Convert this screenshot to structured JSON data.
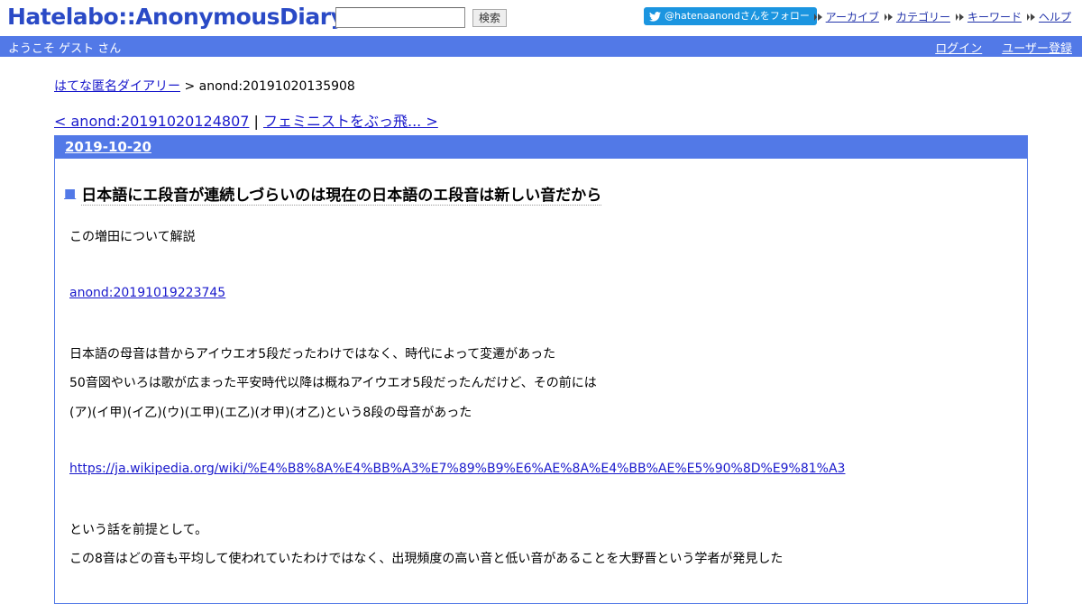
{
  "header": {
    "logo": "Hatelabo::AnonymousDiary",
    "search_value": "",
    "search_button": "検索",
    "follow_button": "@hatenaanondさんをフォロー",
    "links": [
      "アーカイブ",
      "カテゴリー",
      "キーワード",
      "ヘルプ"
    ]
  },
  "welcome": {
    "text": "ようこそ ゲスト さん",
    "login": "ログイン",
    "register": "ユーザー登録"
  },
  "breadcrumb": {
    "home": "はてな匿名ダイアリー",
    "separator": " > ",
    "current": "anond:20191020135908"
  },
  "pager": {
    "prev": "< anond:20191020124807",
    "divider": " | ",
    "next": "フェミニストをぶっ飛... >"
  },
  "entry": {
    "date": "2019-10-20",
    "title_mark": "■",
    "title": "日本語にエ段音が連続しづらいのは現在の日本語のエ段音は新しい音だから",
    "lines": {
      "p1": "この増田について解説",
      "link1": "anond:20191019223745",
      "p2": "日本語の母音は昔からアイウエオ5段だったわけではなく、時代によって変遷があった",
      "p3": "50音図やいろは歌が広まった平安時代以降は概ねアイウエオ5段だったんだけど、その前には",
      "p4": "(ア)(イ甲)(イ乙)(ウ)(エ甲)(エ乙)(オ甲)(オ乙)という8段の母音があった",
      "link2": "https://ja.wikipedia.org/wiki/%E4%B8%8A%E4%BB%A3%E7%89%B9%E6%AE%8A%E4%BB%AE%E5%90%8D%E9%81%A3",
      "p5": "という話を前提として。",
      "p6": "この8音はどの音も平均して使われていたわけではなく、出現頻度の高い音と低い音があることを大野晋という学者が発見した"
    }
  },
  "colors": {
    "logo": "#2a4ac6",
    "bar": "#5279e7",
    "twitter": "#1b95e0",
    "link": "#1a1acc"
  }
}
